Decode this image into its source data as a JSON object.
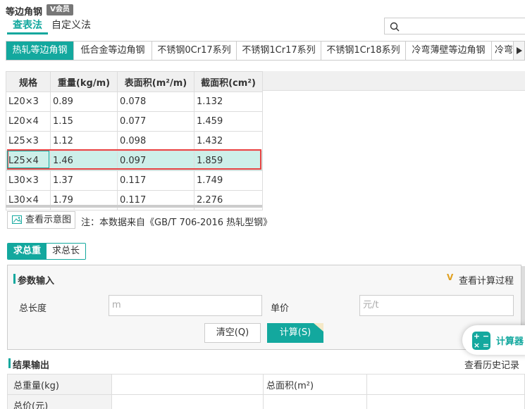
{
  "header": {
    "title": "等边角钢",
    "vip_badge": "会员"
  },
  "tabs": [
    {
      "label": "查表法"
    },
    {
      "label": "自定义法"
    }
  ],
  "search": {
    "placeholder": ""
  },
  "subtabs": [
    "热轧等边角钢",
    "低合金等边角钢",
    "不锈钢0Cr17系列",
    "不锈钢1Cr17系列",
    "不锈钢1Cr18系列",
    "冷弯薄壁等边角钢",
    "冷弯"
  ],
  "table": {
    "headers": [
      "规格",
      "重量(kg/m)",
      "表面积(m²/m)",
      "截面积(cm²)"
    ],
    "rows": [
      [
        "L20×3",
        "0.89",
        "0.078",
        "1.132"
      ],
      [
        "L20×4",
        "1.15",
        "0.077",
        "1.459"
      ],
      [
        "L25×3",
        "1.12",
        "0.098",
        "1.432"
      ],
      [
        "L25×4",
        "1.46",
        "0.097",
        "1.859"
      ],
      [
        "L30×3",
        "1.37",
        "0.117",
        "1.749"
      ],
      [
        "L30×4",
        "1.79",
        "0.117",
        "2.276"
      ]
    ],
    "selected_row": 3
  },
  "diagram_button": "查看示意图",
  "note": "注：本数据来自《GB/T  706-2016  热轧型钢》",
  "mode": {
    "options": [
      "求总重",
      "求总长"
    ],
    "active": 0
  },
  "params": {
    "title": "参数输入",
    "process_link": "查看计算过程",
    "length_label": "总长度",
    "length_placeholder": "m",
    "price_label": "单价",
    "price_placeholder": "元/t",
    "clear_button": "清空(Q)",
    "calc_button": "计算(S)"
  },
  "float_calc": {
    "label": "计算器"
  },
  "results": {
    "title": "结果输出",
    "history_link": "查看历史记录",
    "rows": [
      [
        "总重量(kg)",
        "",
        "总面积(m²)",
        ""
      ],
      [
        "总价(元)",
        "",
        "",
        ""
      ]
    ]
  },
  "colors": {
    "accent": "#13a89e",
    "highlight_border": "#e84343",
    "selected_row_bg": "#cdefe9"
  }
}
